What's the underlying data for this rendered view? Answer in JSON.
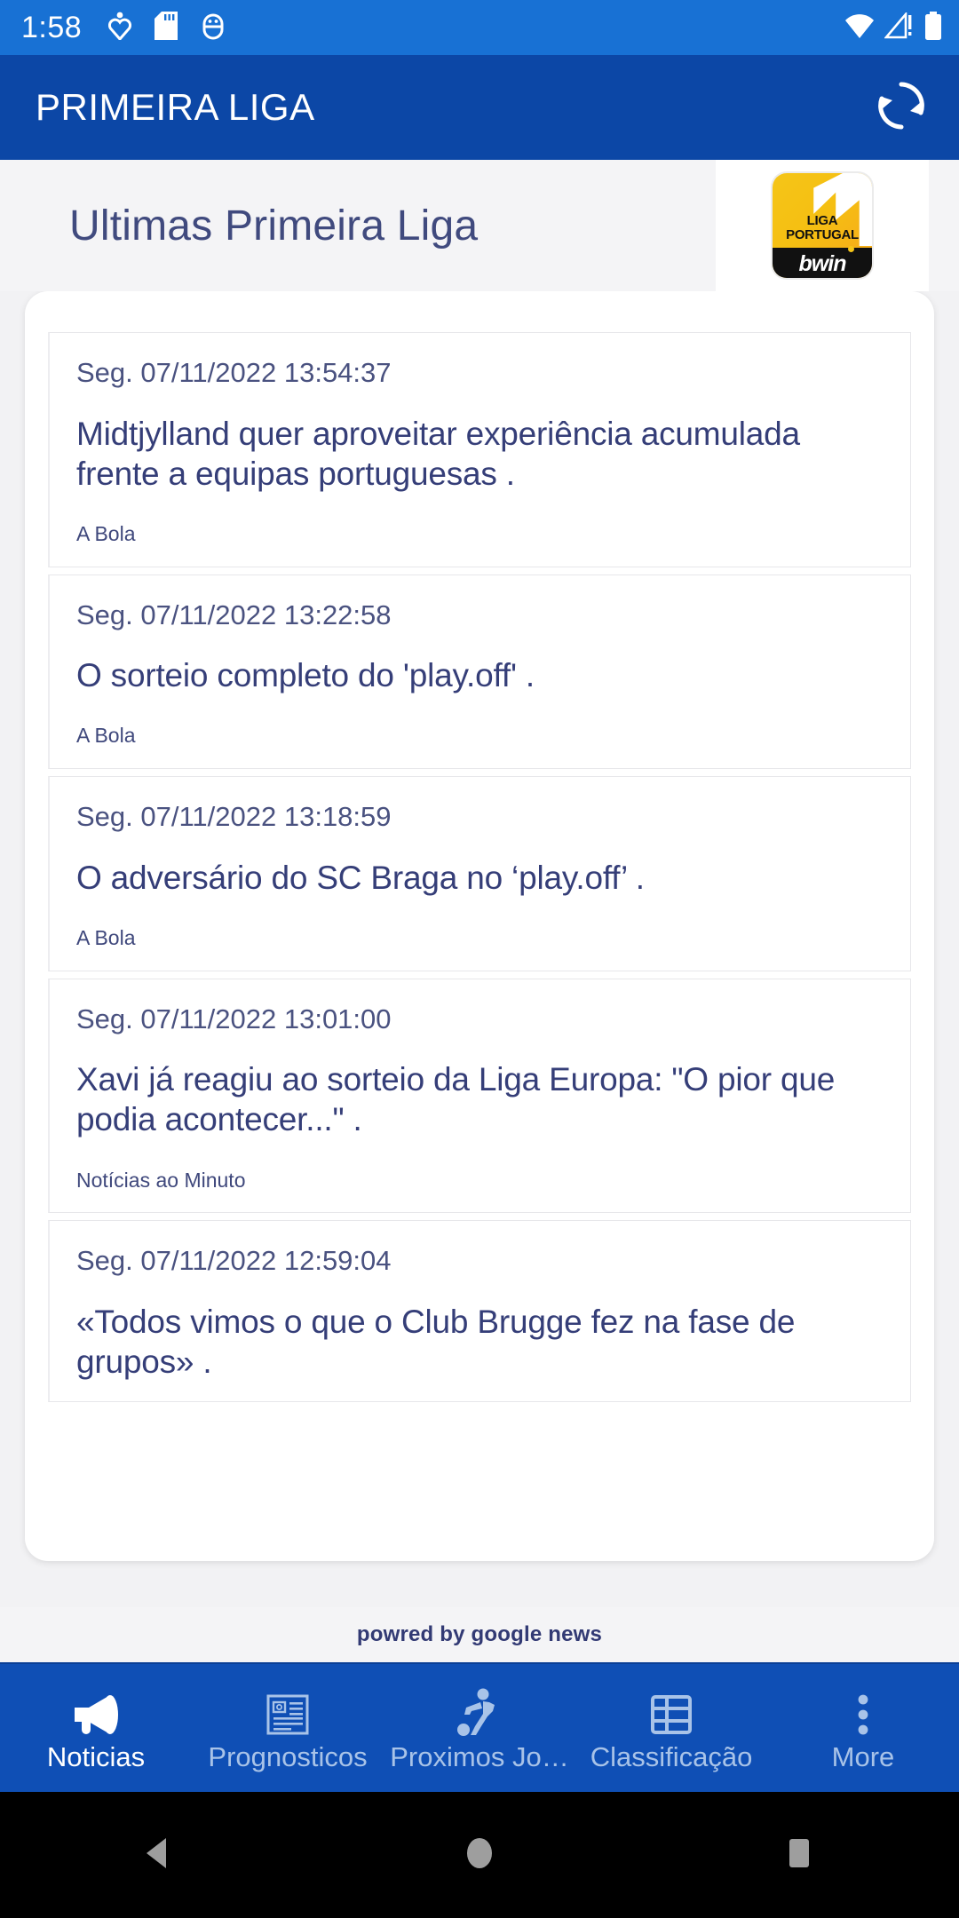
{
  "status_bar": {
    "time": "1:58",
    "left_icons": [
      "download-heart-icon",
      "sd-card-icon",
      "android-debug-icon"
    ],
    "right_icons": [
      "wifi-icon",
      "cellular-no-service-icon",
      "battery-full-icon"
    ],
    "background_color": "#1871d4"
  },
  "app_bar": {
    "title": "PRIMEIRA LIGA",
    "refresh_icon": "refresh-icon",
    "background_color": "#0c47a6"
  },
  "page_header": {
    "title": "Ultimas Primeira Liga",
    "logo": {
      "name": "liga-portugal-bwin-logo",
      "line1": "LIGA",
      "line2": "PORTUGAL",
      "brand": "bwin",
      "colors": {
        "yellow": "#f5c518",
        "orange": "#f7a71c",
        "black": "#111111"
      }
    },
    "title_color": "#404a7e"
  },
  "news": {
    "items": [
      {
        "date": "Seg. 07/11/2022 13:54:37",
        "title": "Midtjylland quer aproveitar experiência acumulada frente a equipas portuguesas .",
        "source": "A Bola"
      },
      {
        "date": "Seg. 07/11/2022 13:22:58",
        "title": "O sorteio completo do 'play.off' .",
        "source": "A Bola"
      },
      {
        "date": "Seg. 07/11/2022 13:18:59",
        "title": "O adversário do SC Braga no ‘play.off’ .",
        "source": "A Bola"
      },
      {
        "date": "Seg. 07/11/2022 13:01:00",
        "title": "Xavi já reagiu ao sorteio da Liga Europa: \"O pior que podia acontecer...\" .",
        "source": "Notícias ao Minuto"
      },
      {
        "date": "Seg. 07/11/2022 12:59:04",
        "title": "«Todos vimos o que o Club Brugge fez na fase de grupos» .",
        "source": ""
      }
    ]
  },
  "footer": {
    "powered_by": "powred by google news"
  },
  "bottom_nav": {
    "active_color": "#ffffff",
    "inactive_color": "#a8c3e8",
    "background_color": "#0f4fb5",
    "items": [
      {
        "label": "Noticias",
        "icon": "megaphone-icon",
        "active": true
      },
      {
        "label": "Prognosticos",
        "icon": "article-icon",
        "active": false
      },
      {
        "label": "Proximos Jo…",
        "icon": "soccer-player-icon",
        "active": false
      },
      {
        "label": "Classificação",
        "icon": "table-grid-icon",
        "active": false
      },
      {
        "label": "More",
        "icon": "more-vertical-icon",
        "active": false
      }
    ]
  },
  "system_nav": {
    "buttons": [
      "back-icon",
      "home-icon",
      "recents-icon"
    ]
  }
}
